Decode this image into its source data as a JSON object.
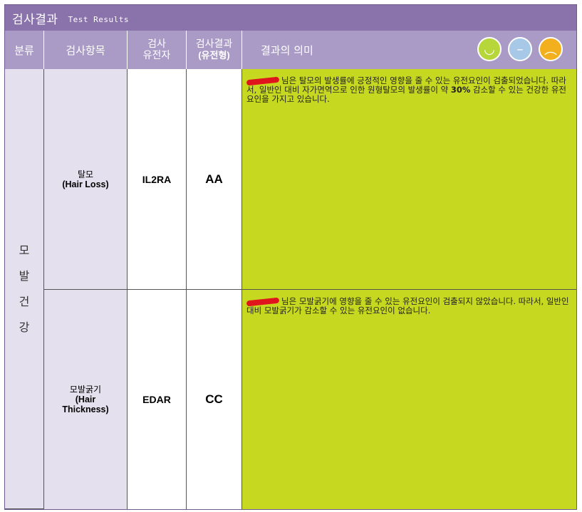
{
  "title": {
    "ko": "검사결과",
    "en": "Test Results"
  },
  "headers": {
    "category": "분류",
    "item": "검사항목",
    "gene_l1": "검사",
    "gene_l2": "유전자",
    "result_l1": "검사결과",
    "result_l2": "(유전형)",
    "meaning": "결과의 의미"
  },
  "faces": [
    {
      "name": "good",
      "color": "#b7d63a"
    },
    {
      "name": "neutral",
      "color": "#a8c8e8"
    },
    {
      "name": "bad",
      "color": "#f2b01e"
    }
  ],
  "category": [
    "모",
    "발",
    "건",
    "강"
  ],
  "rows": [
    {
      "item_ko": "탈모",
      "item_en": "(Hair Loss)",
      "gene": "IL2RA",
      "result": "AA",
      "meaning_a": "님은 탈모의 발생률에 긍정적인 영향을 줄 수 있는 유전요인이 검출되었습니다. 따라서, 일반인 대비 자가면역으로 인한 원형탈모의 발생률이 약 ",
      "meaning_bold": "30%",
      "meaning_b": " 감소할 수 있는 건강한 유전요인을 가지고 있습니다."
    },
    {
      "item_ko": "모발굵기",
      "item_en": "(Hair Thickness)",
      "gene": "EDAR",
      "result": "CC",
      "meaning_a": "님은 모발굵기에 영향을 줄 수 있는 유전요인이 검출되지 않았습니다. 따라서, 일반인 대비 모발굵기가 감소할 수 있는 유전요인이 없습니다.",
      "meaning_bold": "",
      "meaning_b": ""
    }
  ]
}
